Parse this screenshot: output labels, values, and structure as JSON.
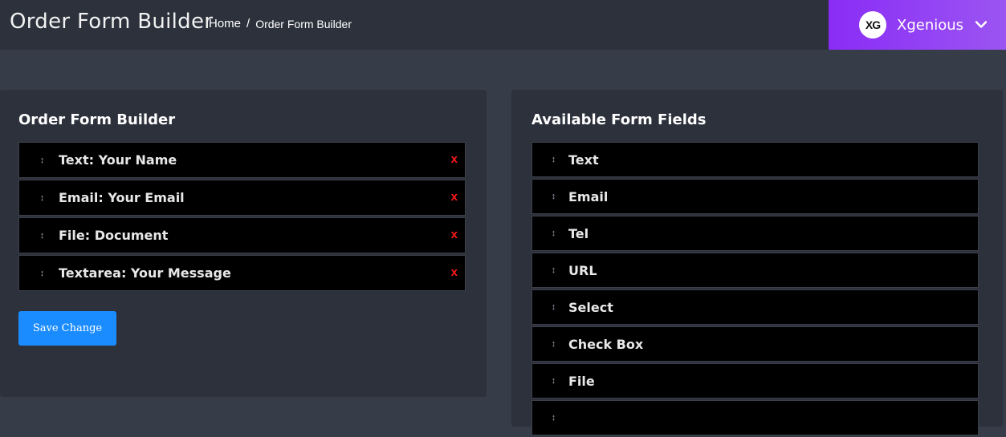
{
  "header": {
    "title": "Order Form Builder",
    "breadcrumb": {
      "home": "Home",
      "separator": "/",
      "current": "Order Form Builder"
    },
    "user": {
      "avatar_text": "XG",
      "name": "Xgenious",
      "dropdown_icon": "chevron-down-icon"
    }
  },
  "builder": {
    "title": "Order Form Builder",
    "fields": [
      {
        "label": "Text: Your Name",
        "remove": "x"
      },
      {
        "label": "Email: Your Email",
        "remove": "x"
      },
      {
        "label": "File: Document",
        "remove": "x"
      },
      {
        "label": "Textarea: Your Message",
        "remove": "x"
      }
    ],
    "save_label": "Save Change"
  },
  "available": {
    "title": "Available Form Fields",
    "fields": [
      "Text",
      "Email",
      "Tel",
      "URL",
      "Select",
      "Check Box",
      "File",
      ""
    ]
  },
  "icons": {
    "drag_handle": "drag-handle-icon",
    "handle_glyph": "↕"
  },
  "colors": {
    "accent_gradient_start": "#8a2cf6",
    "accent_gradient_end": "#9b55f2",
    "save_button": "#1a8cff",
    "remove": "#ff1a1a",
    "panel": "#2c313c",
    "background": "#363c48"
  }
}
